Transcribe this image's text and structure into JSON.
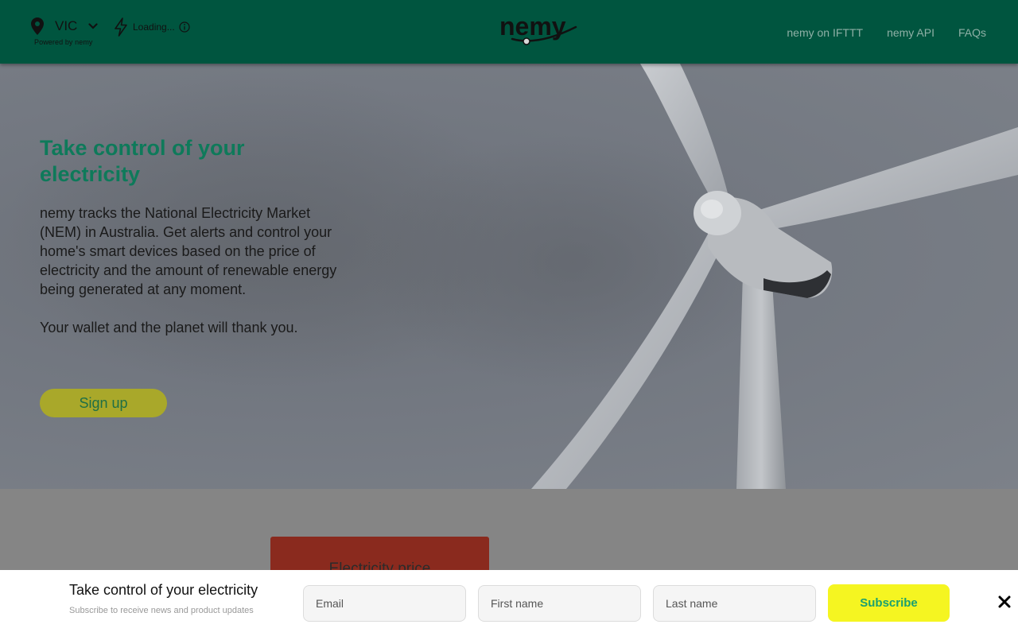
{
  "header": {
    "region": {
      "name": "VIC",
      "powered_by": "Powered by nemy"
    },
    "status": {
      "text": "Loading..."
    },
    "logo": {
      "text": "nemy"
    },
    "nav": [
      {
        "label": "nemy on IFTTT"
      },
      {
        "label": "nemy API"
      },
      {
        "label": "FAQs"
      }
    ]
  },
  "hero": {
    "title": "Take control of your electricity",
    "body": "nemy tracks the National Electricity Market (NEM) in Australia. Get alerts and control your home's smart devices based on the price of electricity and the amount of renewable energy being generated at any moment.\n\nYour wallet and the planet will thank you.",
    "signup_label": "Sign up"
  },
  "price_card": {
    "title": "Electricity price"
  },
  "subscribe_bar": {
    "title": "Take control of your electricity",
    "subtitle": "Subscribe to receive news and product updates",
    "email_placeholder": "Email",
    "first_name_placeholder": "First name",
    "last_name_placeholder": "Last name",
    "button_label": "Subscribe"
  },
  "colors": {
    "header_bg": "#00553f",
    "hero_title": "#0e7a5a",
    "signup_bg": "#a9a82a",
    "subscribe_bg": "#f5f521",
    "price_card_bg": "#8a2a1e"
  }
}
